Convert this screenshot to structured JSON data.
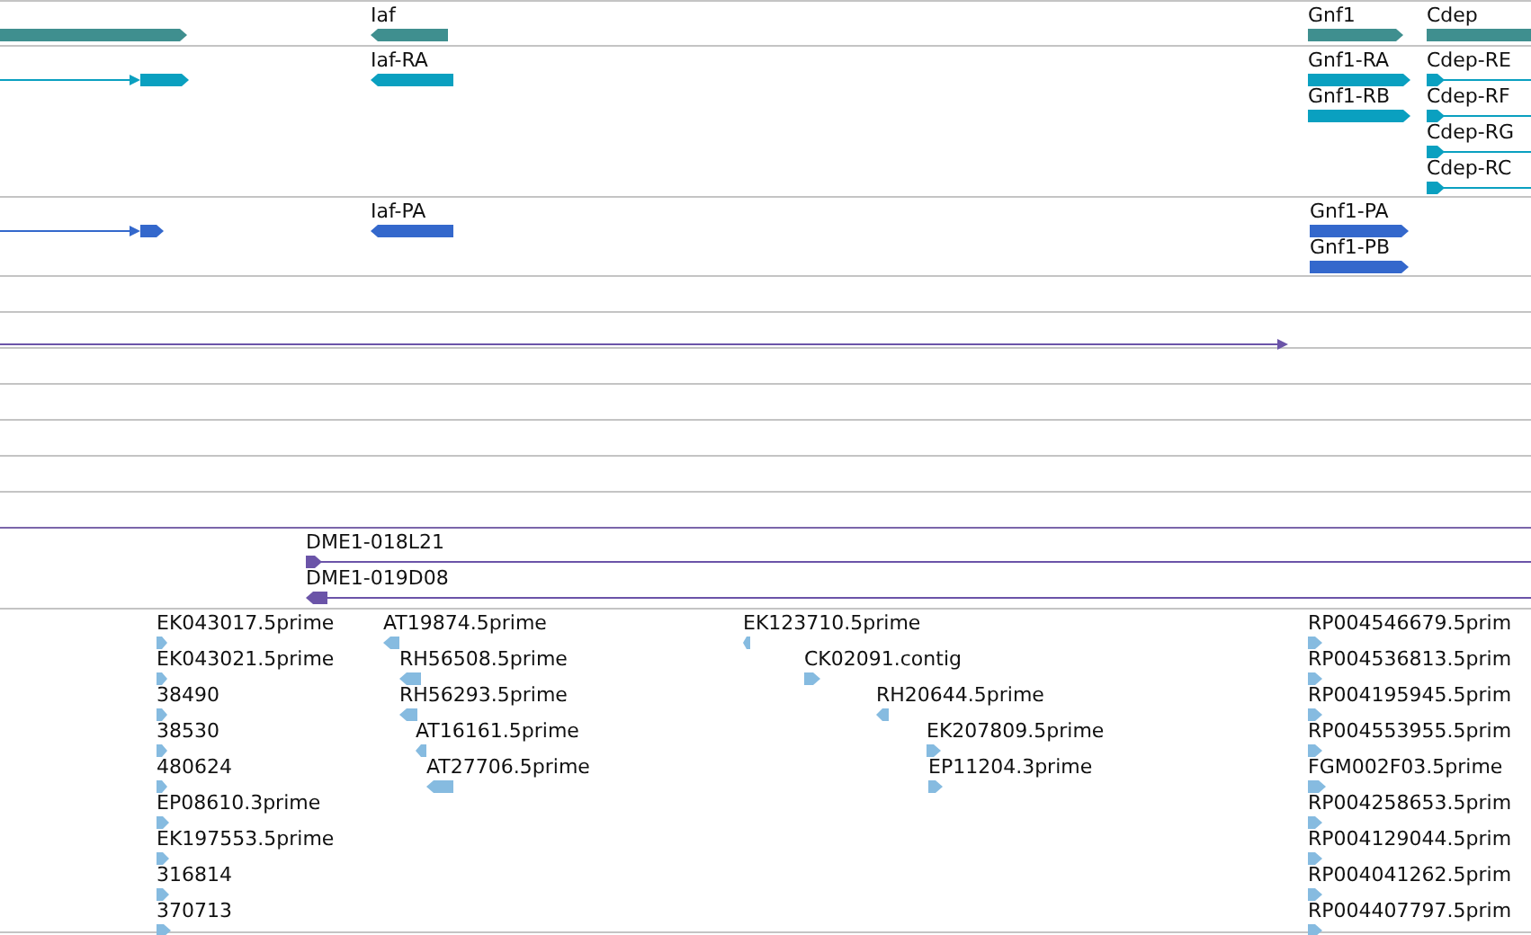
{
  "tracks": [
    {
      "kind": "gene",
      "features": [
        {
          "label": "Iaf",
          "reverse": true
        },
        {
          "label": "Gnf1",
          "reverse": false
        },
        {
          "label": "Cdep"
        }
      ]
    },
    {
      "kind": "transcript",
      "features": [
        {
          "label": "Iaf-RA",
          "reverse": true
        },
        {
          "label": "Gnf1-RA",
          "reverse": false
        },
        {
          "label": "Gnf1-RB",
          "reverse": false
        },
        {
          "label": "Cdep-RE",
          "reverse": false
        },
        {
          "label": "Cdep-RF",
          "reverse": false
        },
        {
          "label": "Cdep-RG",
          "reverse": false
        },
        {
          "label": "Cdep-RC",
          "reverse": false
        }
      ]
    },
    {
      "kind": "protein",
      "features": [
        {
          "label": "Iaf-PA",
          "reverse": true
        },
        {
          "label": "Gnf1-PA",
          "reverse": false
        },
        {
          "label": "Gnf1-PB",
          "reverse": false
        }
      ]
    },
    {
      "kind": "clone",
      "features": [
        {
          "label": "DME1-018L21",
          "reverse": false
        },
        {
          "label": "DME1-019D08",
          "reverse": true
        }
      ]
    },
    {
      "kind": "est",
      "features": [
        {
          "label": "EK043017.5prime",
          "reverse": false
        },
        {
          "label": "EK043021.5prime",
          "reverse": false
        },
        {
          "label": "38490",
          "reverse": false
        },
        {
          "label": "38530",
          "reverse": false
        },
        {
          "label": "480624",
          "reverse": false
        },
        {
          "label": "EP08610.3prime",
          "reverse": false
        },
        {
          "label": "EK197553.5prime",
          "reverse": false
        },
        {
          "label": "316814",
          "reverse": false
        },
        {
          "label": "370713",
          "reverse": false
        },
        {
          "label": "AT19874.5prime",
          "reverse": true
        },
        {
          "label": "RH56508.5prime",
          "reverse": true
        },
        {
          "label": "RH56293.5prime",
          "reverse": true
        },
        {
          "label": "AT16161.5prime",
          "reverse": true
        },
        {
          "label": "AT27706.5prime",
          "reverse": true
        },
        {
          "label": "EK123710.5prime",
          "reverse": true
        },
        {
          "label": "CK02091.contig",
          "reverse": false
        },
        {
          "label": "RH20644.5prime",
          "reverse": true
        },
        {
          "label": "EK207809.5prime",
          "reverse": false
        },
        {
          "label": "EP11204.3prime",
          "reverse": false
        },
        {
          "label": "RP004546679.5prim",
          "reverse": false
        },
        {
          "label": "RP004536813.5prim",
          "reverse": false
        },
        {
          "label": "RP004195945.5prim",
          "reverse": false
        },
        {
          "label": "RP004553955.5prim",
          "reverse": false
        },
        {
          "label": "FGM002F03.5prime",
          "reverse": false
        },
        {
          "label": "RP004258653.5prim",
          "reverse": false
        },
        {
          "label": "RP004129044.5prim",
          "reverse": false
        },
        {
          "label": "RP004041262.5prim",
          "reverse": false
        },
        {
          "label": "RP004407797.5prim",
          "reverse": false
        }
      ]
    }
  ]
}
